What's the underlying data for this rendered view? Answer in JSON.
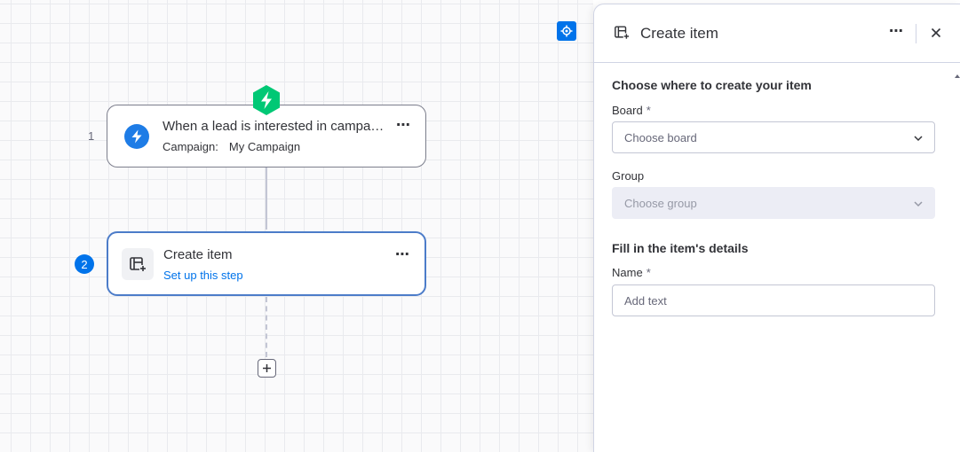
{
  "canvas": {
    "steps": [
      {
        "number": "1",
        "title": "When a lead is interested in campaign",
        "campaign_label": "Campaign:",
        "campaign_value": "My Campaign",
        "icon": "lightning-bolt-icon"
      },
      {
        "number": "2",
        "title": "Create item",
        "subtitle": "Set up this step",
        "icon": "create-item-icon"
      }
    ],
    "more_icon": "⋯",
    "add_step_icon": "plus-icon",
    "recenter_icon": "target-icon"
  },
  "panel": {
    "title": "Create item",
    "more_icon": "⋯",
    "close_icon": "close-icon",
    "section1_title": "Choose where to create your item",
    "board_label": "Board",
    "board_required": "*",
    "board_placeholder": "Choose board",
    "group_label": "Group",
    "group_placeholder": "Choose group",
    "section2_title": "Fill in the item's details",
    "name_label": "Name",
    "name_required": "*",
    "name_placeholder": "Add text"
  },
  "colors": {
    "accent": "#0073ea",
    "trigger_badge": "#00c875",
    "text": "#323338",
    "muted": "#676879"
  }
}
